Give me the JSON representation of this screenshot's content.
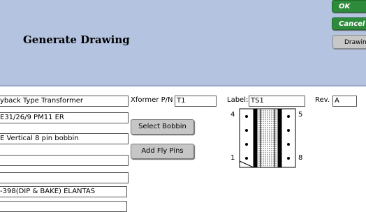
{
  "header": {
    "title": "Generate Drawing",
    "ok_label": "OK",
    "cancel_label": "Cancel",
    "drawing_label": "Drawing"
  },
  "form": {
    "left_fields": [
      "yback Type Transformer",
      "E31/26/9 PM11 ER",
      "E Vertical 8 pin bobbin",
      "",
      "",
      "-398(DIP & BAKE) ELANTAS"
    ],
    "xformer_pn_label": "Xformer P/N",
    "xformer_pn_value": "T1",
    "label_label": "Label:",
    "label_value": "TS1",
    "rev_label": "Rev.",
    "rev_value": "A",
    "select_bobbin_label": "Select Bobbin",
    "add_fly_pins_label": "Add Fly Pins"
  },
  "bobbin": {
    "pin_top_left": "4",
    "pin_top_right": "5",
    "pin_bottom_left": "1",
    "pin_bottom_right": "8"
  }
}
